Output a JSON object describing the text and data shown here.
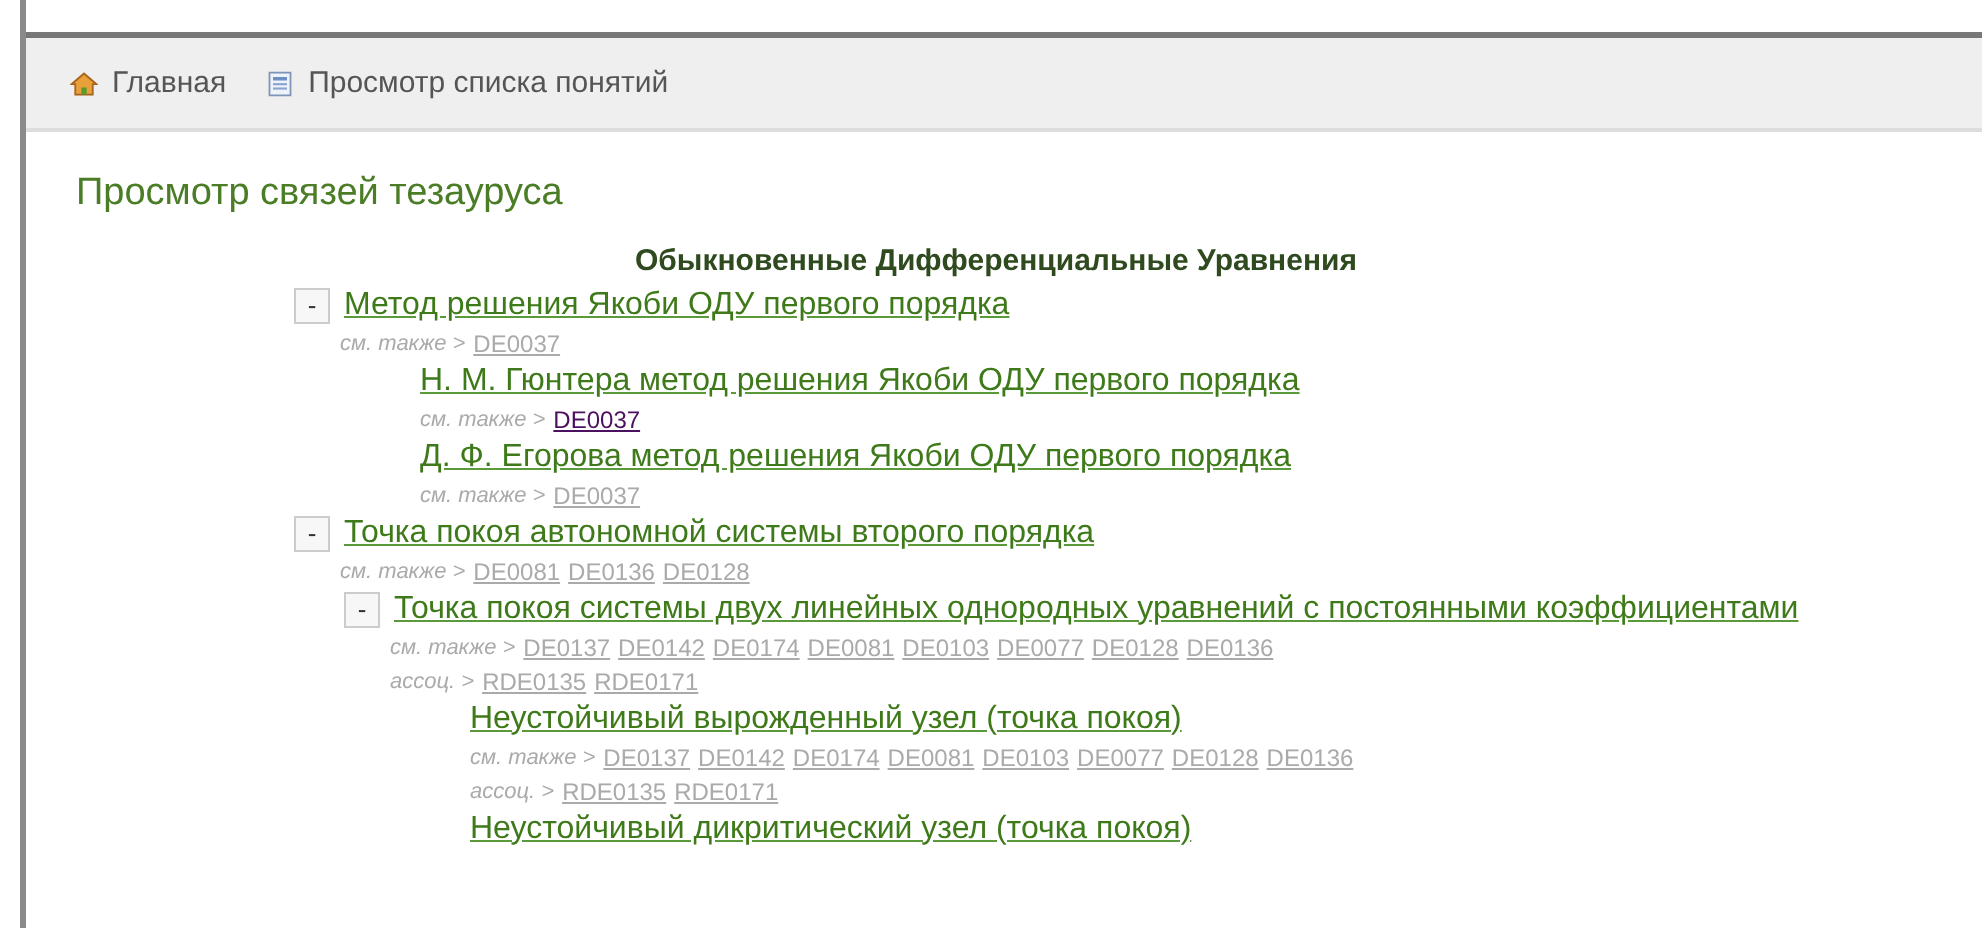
{
  "nav": [
    {
      "kind": "home",
      "label": "Главная"
    },
    {
      "kind": "list",
      "label": "Просмотр списка понятий"
    }
  ],
  "page_title": "Просмотр связей тезауруса",
  "heading": "Обыкновенные Дифференциальные Уравнения",
  "tree": [
    {
      "toggle": "-",
      "title": "Метод решения Якоби ОДУ первого порядка",
      "relations": [
        {
          "label": "см. также >",
          "links": [
            {
              "text": "DE0037",
              "visited": false
            }
          ]
        }
      ],
      "children": [
        {
          "title": "Н. М. Гюнтера метод решения Якоби ОДУ первого порядка",
          "relations": [
            {
              "label": "см. также >",
              "links": [
                {
                  "text": "DE0037",
                  "visited": true
                }
              ]
            }
          ]
        },
        {
          "title": "Д. Ф. Егорова метод решения Якоби ОДУ первого порядка",
          "relations": [
            {
              "label": "см. также >",
              "links": [
                {
                  "text": "DE0037",
                  "visited": false
                }
              ]
            }
          ]
        }
      ]
    },
    {
      "toggle": "-",
      "title": "Точка покоя автономной системы второго порядка",
      "relations": [
        {
          "label": "см. также >",
          "links": [
            {
              "text": "DE0081",
              "visited": false
            },
            {
              "text": "DE0136",
              "visited": false
            },
            {
              "text": "DE0128",
              "visited": false
            }
          ]
        }
      ],
      "children": [
        {
          "toggle": "-",
          "title": "Точка покоя системы двух линейных однородных уравнений с постоянными коэффициентами",
          "relations": [
            {
              "label": "см. также >",
              "links": [
                {
                  "text": "DE0137",
                  "visited": false
                },
                {
                  "text": "DE0142",
                  "visited": false
                },
                {
                  "text": "DE0174",
                  "visited": false
                },
                {
                  "text": "DE0081",
                  "visited": false
                },
                {
                  "text": "DE0103",
                  "visited": false
                },
                {
                  "text": "DE0077",
                  "visited": false
                },
                {
                  "text": "DE0128",
                  "visited": false
                },
                {
                  "text": "DE0136",
                  "visited": false
                }
              ]
            },
            {
              "label": "ассоц. >",
              "links": [
                {
                  "text": "RDE0135",
                  "visited": false
                },
                {
                  "text": "RDE0171",
                  "visited": false
                }
              ]
            }
          ],
          "children": [
            {
              "title": "Неустойчивый вырожденный узел (точка покоя)",
              "relations": [
                {
                  "label": "см. также >",
                  "links": [
                    {
                      "text": "DE0137",
                      "visited": false
                    },
                    {
                      "text": "DE0142",
                      "visited": false
                    },
                    {
                      "text": "DE0174",
                      "visited": false
                    },
                    {
                      "text": "DE0081",
                      "visited": false
                    },
                    {
                      "text": "DE0103",
                      "visited": false
                    },
                    {
                      "text": "DE0077",
                      "visited": false
                    },
                    {
                      "text": "DE0128",
                      "visited": false
                    },
                    {
                      "text": "DE0136",
                      "visited": false
                    }
                  ]
                },
                {
                  "label": "ассоц. >",
                  "links": [
                    {
                      "text": "RDE0135",
                      "visited": false
                    },
                    {
                      "text": "RDE0171",
                      "visited": false
                    }
                  ]
                }
              ]
            },
            {
              "title": "Неустойчивый дикритический узел (точка покоя)"
            }
          ]
        }
      ]
    }
  ]
}
